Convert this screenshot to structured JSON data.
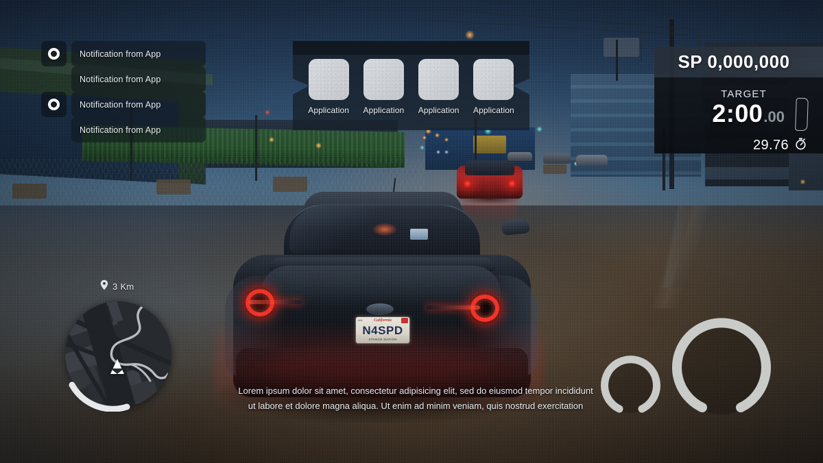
{
  "notifications": {
    "items": [
      {
        "text": "Notification from App",
        "has_badge": true,
        "badge_icon": "circle-ring-icon"
      },
      {
        "text": "Notification from App",
        "has_badge": false,
        "badge_icon": ""
      },
      {
        "text": "Notification from App",
        "has_badge": true,
        "badge_icon": "circle-ring-icon"
      },
      {
        "text": "Notification from App",
        "has_badge": false,
        "badge_icon": ""
      }
    ]
  },
  "app_bar": {
    "items": [
      {
        "label": "Application"
      },
      {
        "label": "Application"
      },
      {
        "label": "Application"
      },
      {
        "label": "Application"
      }
    ]
  },
  "score_panel": {
    "sp_label": "SP 0,000,000",
    "target_label": "TARGET",
    "target_time_main": "2:00",
    "target_time_frac": ".00",
    "lap_time": "29.76",
    "lap_icon": "stopwatch-icon"
  },
  "minimap": {
    "distance": "3 Km",
    "pin_icon": "map-pin-icon",
    "player_icon": "navigation-arrow-icon"
  },
  "subtitle": {
    "line1": "Lorem ipsum dolor sit amet, consectetur adipisicing elit, sed do eiusmod tempor incididunt",
    "line2": "ut labore et dolore magna aliqua. Ut enim ad minim veniam, quis nostrud exercitation"
  },
  "gauges": {
    "small": {
      "name": "boost-gauge",
      "value_pct": 0
    },
    "large": {
      "name": "speed-gauge",
      "value_pct": 0
    }
  },
  "vehicle": {
    "plate_region": "California",
    "plate_month": "JAN",
    "plate_number": "N4SPD",
    "plate_frame": "STANCE NATION"
  },
  "colors": {
    "hud_panel": "#18202a",
    "hud_text": "#e9edf2",
    "accent_white": "#ffffff",
    "muted_text": "#8d949c",
    "taillight_red": "#ff3428",
    "gauge_ring": "#c9cbc9",
    "sky_top": "#1b2e47",
    "sky_horizon": "#4a6478",
    "road": "#3b332a"
  }
}
